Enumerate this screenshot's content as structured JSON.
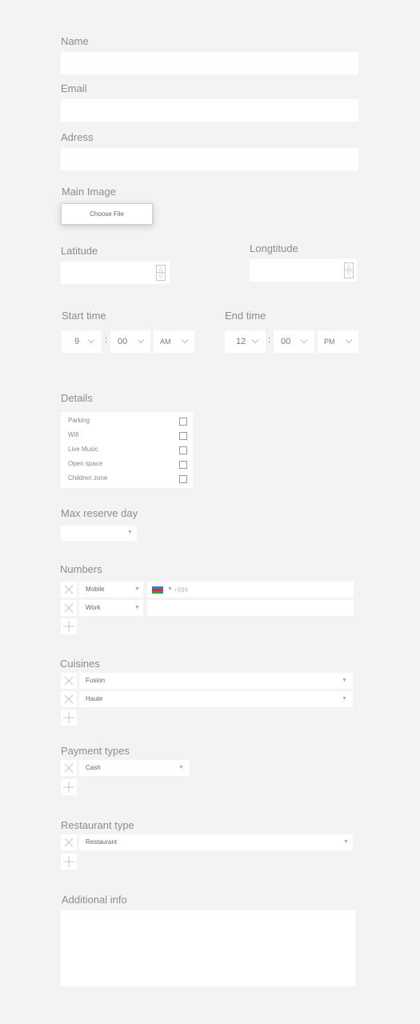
{
  "fields": {
    "name_label": "Name",
    "email_label": "Email",
    "address_label": "Adress",
    "main_image_label": "Main Image",
    "choose_file": "Choose File",
    "latitude_label": "Latitude",
    "longitude_label": "Longtitude"
  },
  "time": {
    "start_label": "Start time",
    "end_label": "End time",
    "start": {
      "hour": "9",
      "minute": "00",
      "ampm": "AM"
    },
    "end": {
      "hour": "12",
      "minute": "00",
      "ampm": "PM"
    },
    "separator": ":"
  },
  "details": {
    "label": "Details",
    "items": [
      "Parking",
      "Wifi",
      "Live Music",
      "Open space",
      "Children zone"
    ]
  },
  "max_reserve": {
    "label": "Max reserve day",
    "value": ""
  },
  "numbers": {
    "label": "Numbers",
    "rows": [
      {
        "type": "Mobile",
        "prefix": "+994"
      },
      {
        "type": "Work",
        "prefix": ""
      }
    ]
  },
  "cuisines": {
    "label": "Cuisines",
    "items": [
      "Fusion",
      "Haute"
    ]
  },
  "payment": {
    "label": "Payment types",
    "items": [
      "Cash"
    ]
  },
  "restaurant_type": {
    "label": "Restaurant type",
    "items": [
      "Restaurant"
    ]
  },
  "additional": {
    "label": "Additional info"
  },
  "icons": {
    "remove": "close-icon",
    "add": "plus-icon",
    "flag": "azerbaijan-flag-icon"
  }
}
